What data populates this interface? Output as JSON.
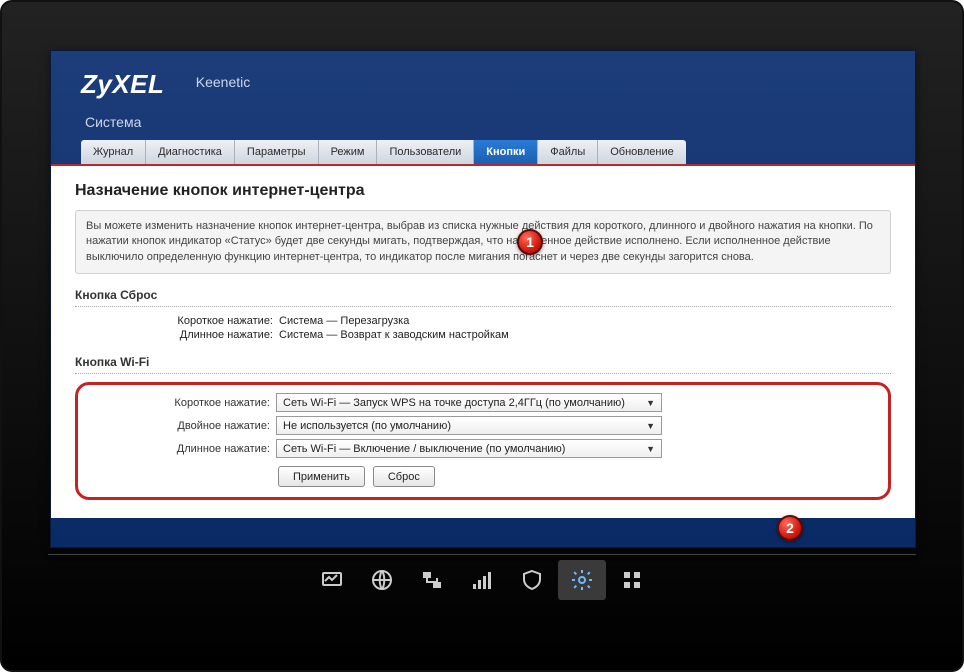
{
  "header": {
    "brand": "ZyXEL",
    "model": "Keenetic",
    "section": "Система"
  },
  "tabs": [
    {
      "label": "Журнал"
    },
    {
      "label": "Диагностика"
    },
    {
      "label": "Параметры"
    },
    {
      "label": "Режим"
    },
    {
      "label": "Пользователи"
    },
    {
      "label": "Кнопки",
      "active": true
    },
    {
      "label": "Файлы"
    },
    {
      "label": "Обновление"
    }
  ],
  "page": {
    "title": "Назначение кнопок интернет-центра",
    "description": "Вы можете изменить назначение кнопок интернет-центра, выбрав из списка нужные действия для короткого, длинного и двойного нажатия на кнопки. По нажатии кнопок индикатор «Статус» будет две секунды мигать, подтверждая, что назначенное действие исполнено. Если исполненное действие выключило определенную функцию интернет-центра, то индикатор после мигания погаснет и через две секунды загорится снова."
  },
  "reset_block": {
    "title": "Кнопка Сброс",
    "rows": [
      {
        "label": "Короткое нажатие:",
        "value": "Система — Перезагрузка"
      },
      {
        "label": "Длинное нажатие:",
        "value": "Система — Возврат к заводским настройкам"
      }
    ]
  },
  "wifi_block": {
    "title": "Кнопка Wi-Fi",
    "rows": [
      {
        "label": "Короткое нажатие:",
        "value": "Сеть Wi-Fi — Запуск WPS на точке доступа 2,4ГГц (по умолчанию)"
      },
      {
        "label": "Двойное нажатие:",
        "value": "Не используется (по умолчанию)"
      },
      {
        "label": "Длинное нажатие:",
        "value": "Сеть Wi-Fi — Включение / выключение (по умолчанию)"
      }
    ],
    "actions": {
      "apply": "Применить",
      "reset": "Сброс"
    }
  },
  "badges": {
    "one": "1",
    "two": "2"
  },
  "bottombar_icons": [
    "monitor-icon",
    "globe-icon",
    "lan-icon",
    "wifi-signal-icon",
    "shield-icon",
    "gear-icon",
    "apps-icon"
  ]
}
